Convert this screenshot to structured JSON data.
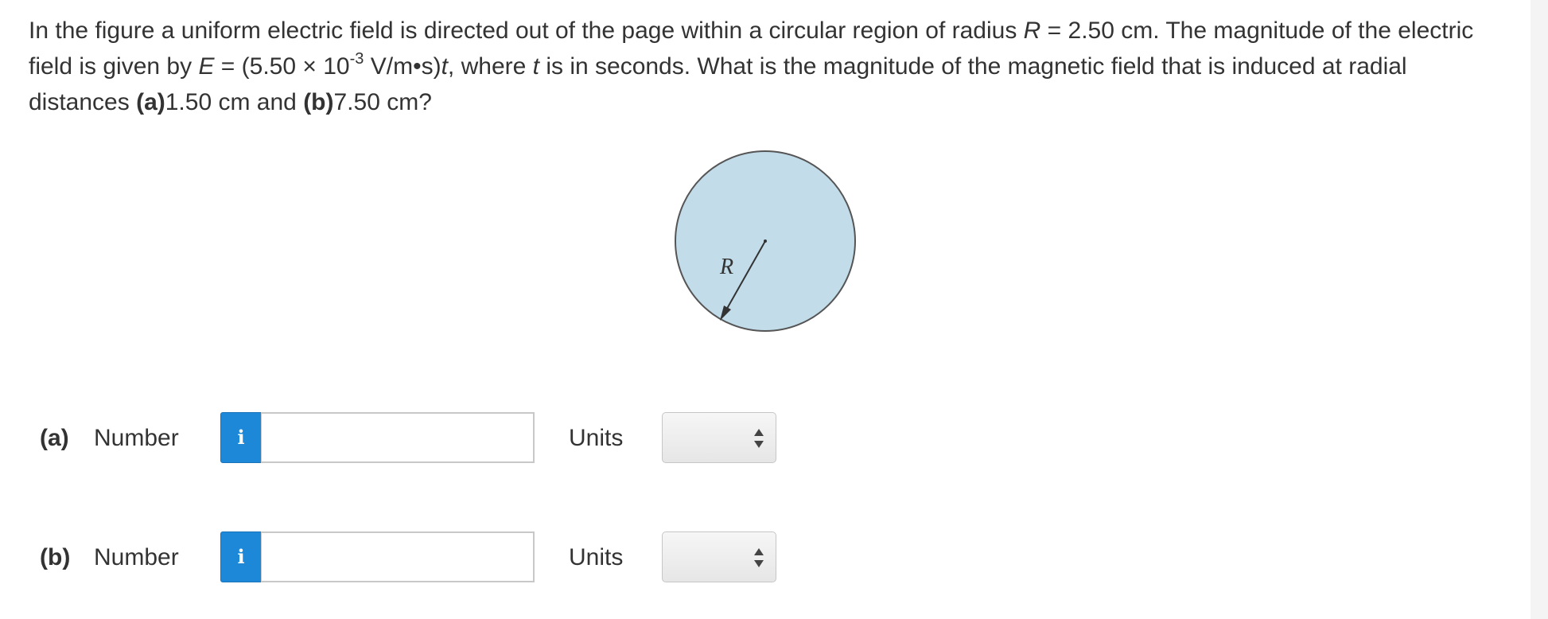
{
  "question": {
    "intro": "In the figure a uniform electric field is directed out of the page within a circular region of radius ",
    "r_symbol": "R",
    "r_value": " = 2.50 cm. The magnitude of the electric field is given by ",
    "e_symbol": "E",
    "e_expr_start": " = (5.50 × 10",
    "exponent": "-3",
    "e_expr_end": " V/m•s)",
    "t_symbol": "t",
    "where_text": ", where ",
    "t_symbol_2": "t",
    "seconds_text": " is in seconds. What is the magnitude of the magnetic field that is induced at radial distances ",
    "part_a_tag": "(a)",
    "part_a_value": "1.50 cm and ",
    "part_b_tag": "(b)",
    "part_b_value": "7.50 cm?"
  },
  "figure": {
    "radius_label": "R",
    "circle_fill": "#c2dcea",
    "circle_stroke": "#555555"
  },
  "answers": [
    {
      "part_label": "(a)",
      "number_label": "Number",
      "info_icon": "i",
      "value": "",
      "units_label": "Units",
      "units_selected": ""
    },
    {
      "part_label": "(b)",
      "number_label": "Number",
      "info_icon": "i",
      "value": "",
      "units_label": "Units",
      "units_selected": ""
    }
  ],
  "colors": {
    "info_button": "#1e88d8",
    "text": "#333333"
  }
}
